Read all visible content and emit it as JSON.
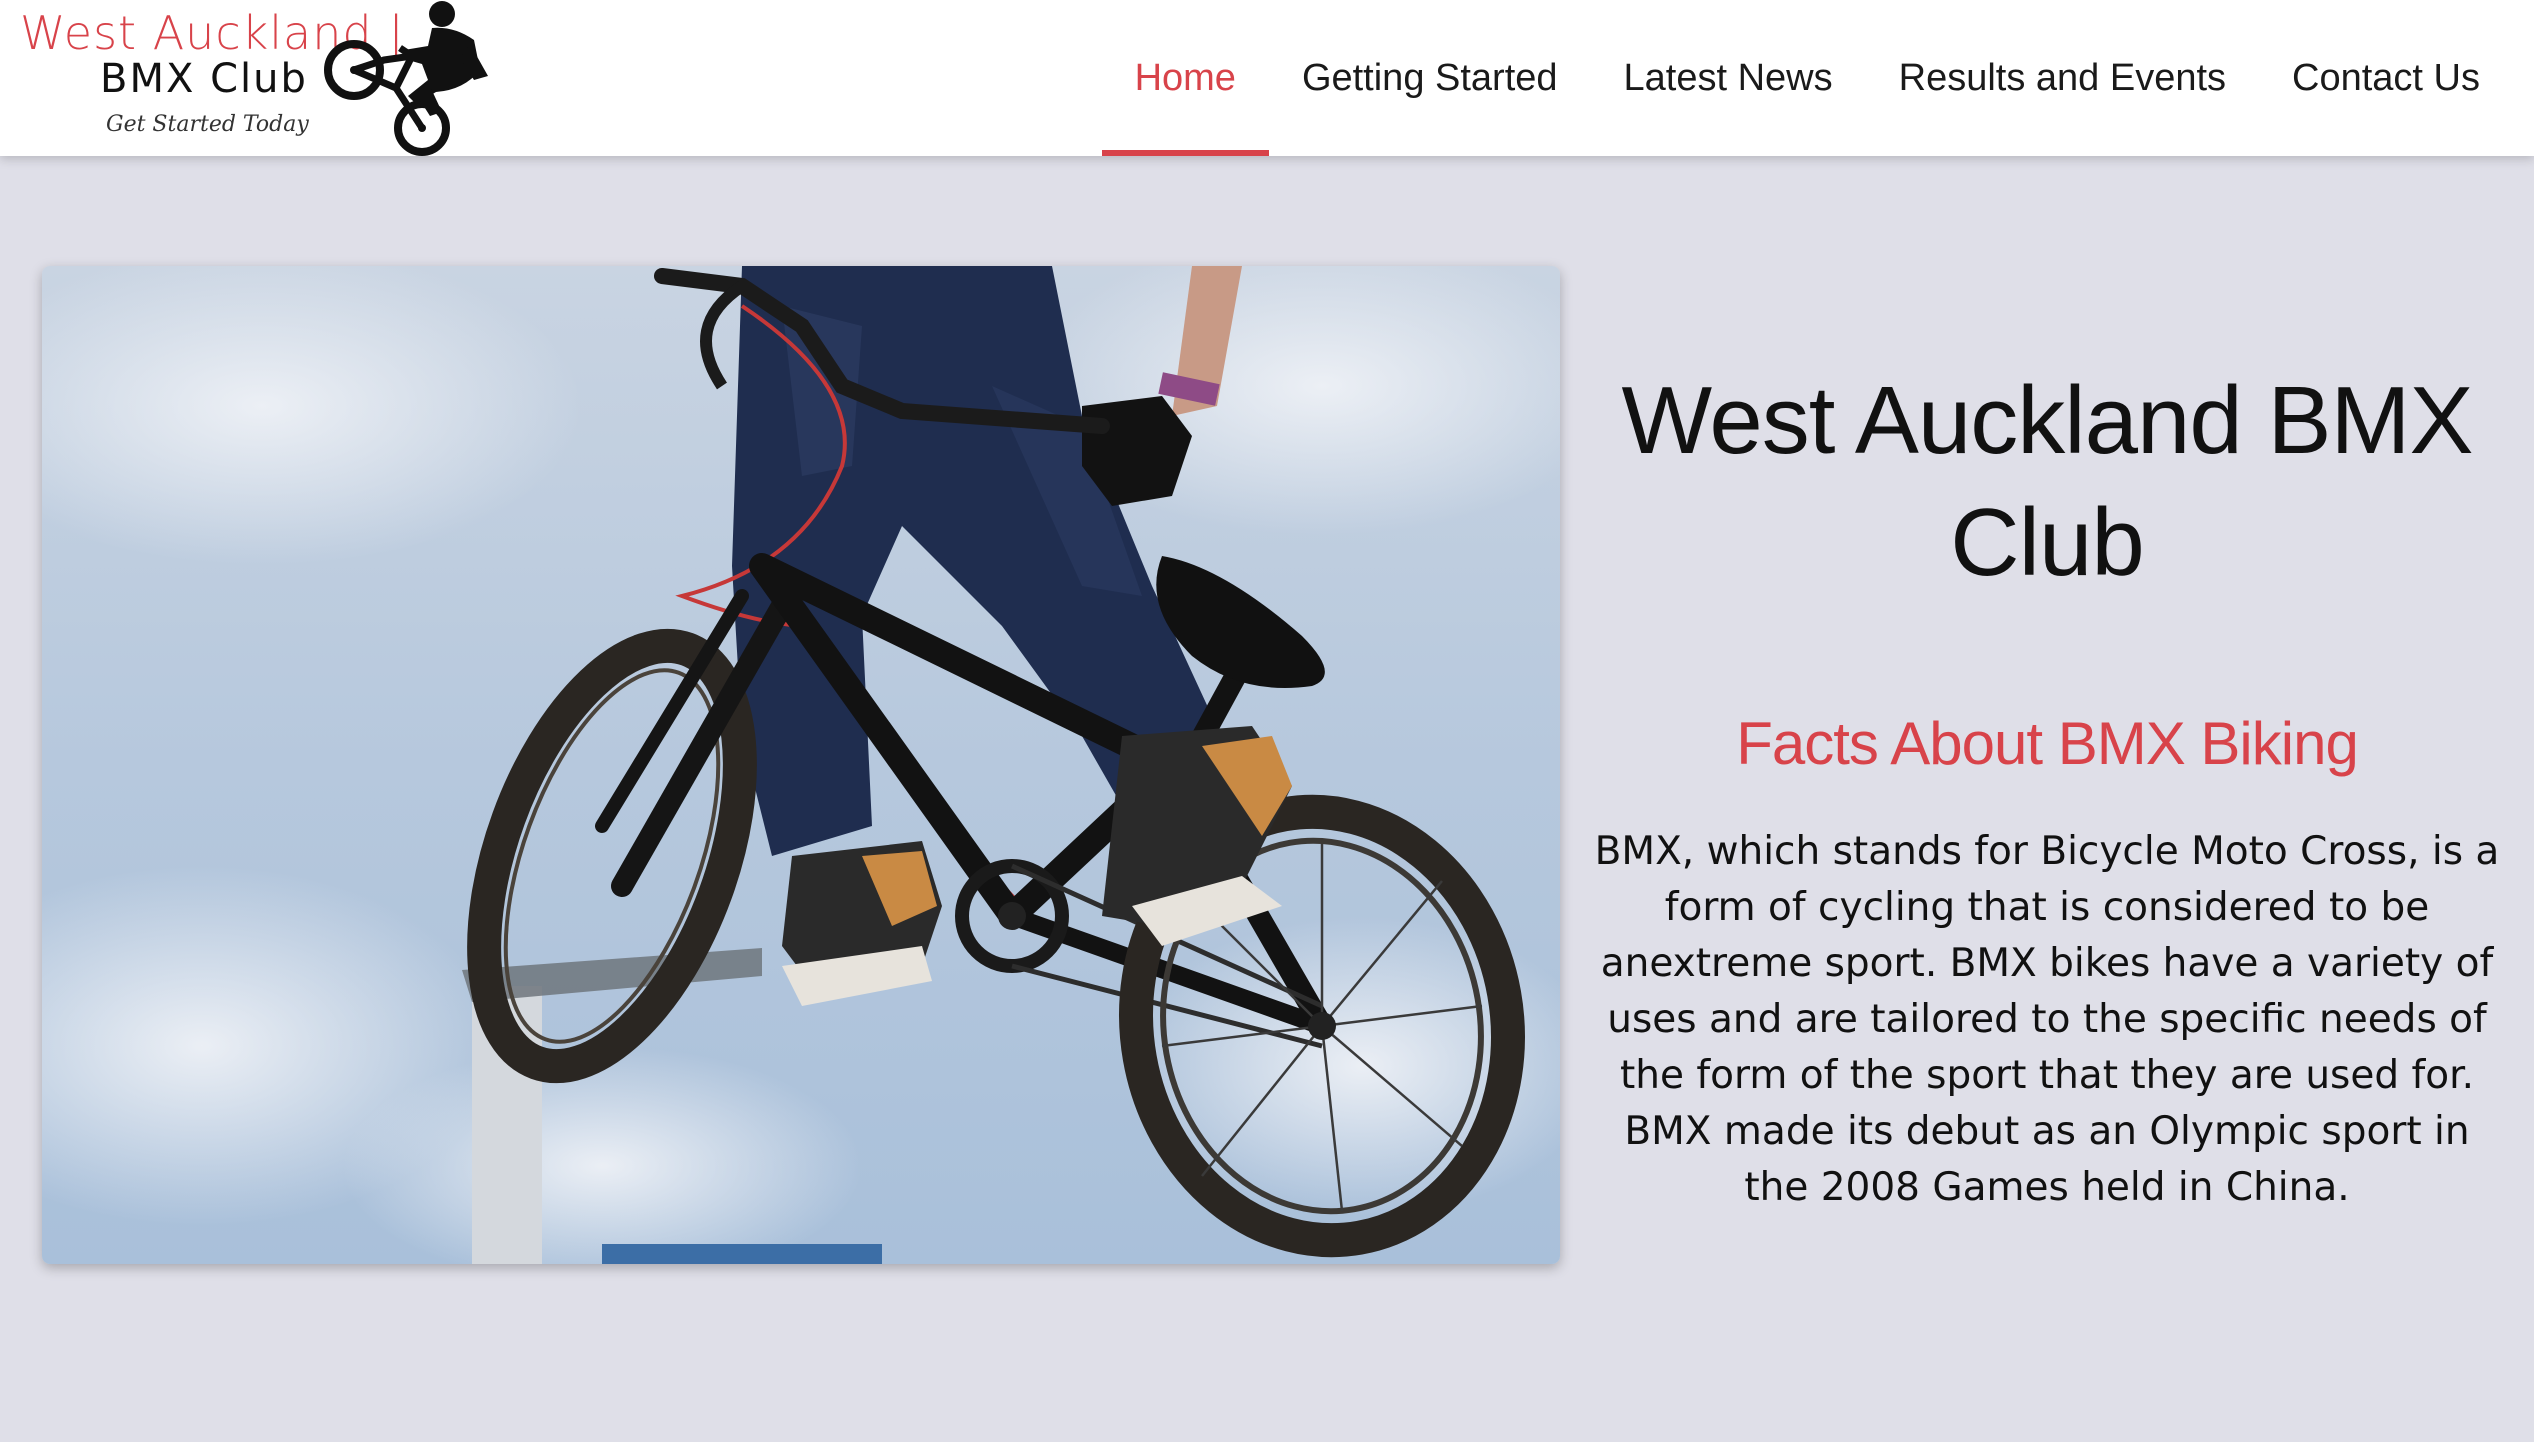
{
  "header": {
    "logo": {
      "title": "West Auckland |",
      "subtitle": "BMX Club",
      "tagline": "Get Started Today",
      "icon": "bmx-rider-silhouette-icon"
    },
    "nav": [
      {
        "label": "Home",
        "active": true
      },
      {
        "label": "Getting Started",
        "active": false
      },
      {
        "label": "Latest News",
        "active": false
      },
      {
        "label": "Results and Events",
        "active": false
      },
      {
        "label": "Contact Us",
        "active": false
      }
    ]
  },
  "hero": {
    "image_subject": "BMX rider mid-air jump"
  },
  "main": {
    "title": "West Auckland BMX Club",
    "subtitle": "Facts About BMX Biking",
    "body": "BMX, which stands for Bicycle Moto Cross, is a form of cycling that is considered to be anextreme sport. BMX bikes have a variety of uses and are tailored to the specific needs of the form of the sport that they are used for. BMX made its debut as an Olympic sport in the 2008 Games held in China."
  },
  "colors": {
    "accent": "#d8434a",
    "page_background": "#dfdfe8",
    "header_background": "#ffffff",
    "text": "#111111"
  }
}
